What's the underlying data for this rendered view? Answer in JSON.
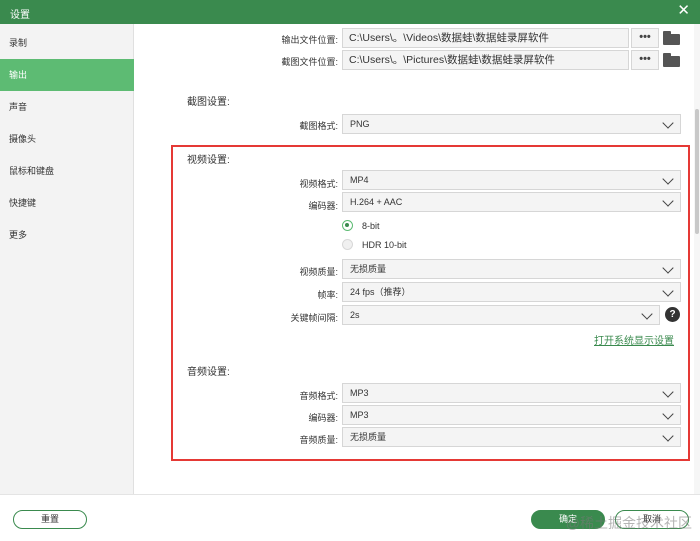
{
  "window": {
    "title": "设置",
    "close_label": "✕"
  },
  "sidebar": {
    "items": [
      {
        "label": "录制",
        "active": false
      },
      {
        "label": "输出",
        "active": true
      },
      {
        "label": "声音",
        "active": false
      },
      {
        "label": "摄像头",
        "active": false
      },
      {
        "label": "鼠标和键盘",
        "active": false
      },
      {
        "label": "快捷键",
        "active": false
      },
      {
        "label": "更多",
        "active": false
      }
    ]
  },
  "output": {
    "output_folder": {
      "label": "输出文件位置:",
      "value": "C:\\Users\\。\\Videos\\数据蛙\\数据蛙录屏软件"
    },
    "screenshot_folder": {
      "label": "截图文件位置:",
      "value": "C:\\Users\\。\\Pictures\\数据蛙\\数据蛙录屏软件"
    },
    "browse_label": "•••"
  },
  "screenshot_settings": {
    "title": "截图设置:",
    "format": {
      "label": "截图格式:",
      "value": "PNG"
    }
  },
  "video_settings": {
    "title": "视频设置:",
    "format": {
      "label": "视频格式:",
      "value": "MP4"
    },
    "encoder": {
      "label": "编码器:",
      "value": "H.264 + AAC"
    },
    "bit_depth": [
      {
        "label": "8-bit",
        "checked": true
      },
      {
        "label": "HDR 10-bit",
        "checked": false
      }
    ],
    "quality": {
      "label": "视频质量:",
      "value": "无损质量"
    },
    "frame_rate": {
      "label": "帧率:",
      "value": "24 fps（推荐）"
    },
    "keyframe_interval": {
      "label": "关键帧间隔:",
      "value": "2s"
    },
    "help_label": "?",
    "display_settings_link": "打开系统显示设置"
  },
  "audio_settings": {
    "title": "音频设置:",
    "format": {
      "label": "音频格式:",
      "value": "MP3"
    },
    "encoder": {
      "label": "编码器:",
      "value": "MP3"
    },
    "quality": {
      "label": "音频质量:",
      "value": "无损质量"
    }
  },
  "footer": {
    "reset_label": "重置",
    "ok_label": "确定",
    "cancel_label": "取消",
    "watermark": "@稀土掘金技术社区"
  },
  "colors": {
    "accent": "#3a8a4e",
    "accent_light": "#5dbb73",
    "highlight_box": "#e53935"
  }
}
